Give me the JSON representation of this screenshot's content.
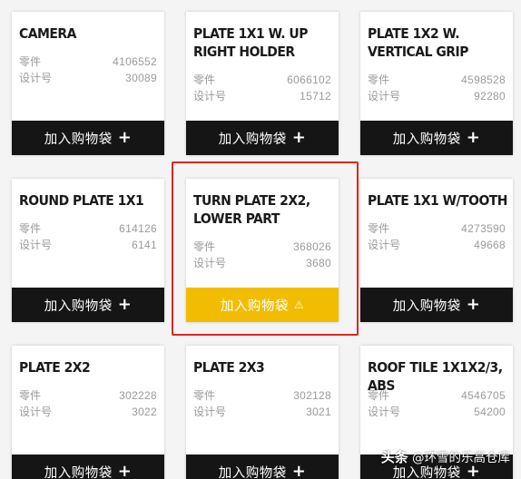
{
  "labels": {
    "part": "零件",
    "design": "设计号",
    "add_to_bag": "加入购物袋"
  },
  "cards": [
    {
      "title": "CAMERA",
      "part": "4106552",
      "design": "30089",
      "state": "available"
    },
    {
      "title": "PLATE 1X1 W. UP RIGHT HOLDER",
      "part": "6066102",
      "design": "15712",
      "state": "available"
    },
    {
      "title": "PLATE 1X2 W. VERTICAL GRIP",
      "part": "4598528",
      "design": "92280",
      "state": "available"
    },
    {
      "title": "ROUND PLATE 1X1",
      "part": "614126",
      "design": "6141",
      "state": "available"
    },
    {
      "title": "TURN PLATE 2X2, LOWER PART",
      "part": "368026",
      "design": "3680",
      "state": "warning"
    },
    {
      "title": "PLATE 1X1 W/TOOTH",
      "part": "4273590",
      "design": "49668",
      "state": "available"
    },
    {
      "title": "PLATE 2X2",
      "part": "302228",
      "design": "3022",
      "state": "available"
    },
    {
      "title": "PLATE 2X3",
      "part": "302128",
      "design": "3021",
      "state": "available"
    },
    {
      "title": "ROOF TILE 1X1X2/3, ABS",
      "part": "4546705",
      "design": "54200",
      "state": "available"
    }
  ],
  "colors": {
    "button": "#151515",
    "warning_button": "#f2bd00",
    "highlight": "#e0261c"
  },
  "icons": {
    "add": "plus-icon",
    "warning": "warning-triangle-icon"
  },
  "watermark": {
    "prefix": "头条",
    "handle": "@环雪的乐高仓库"
  }
}
